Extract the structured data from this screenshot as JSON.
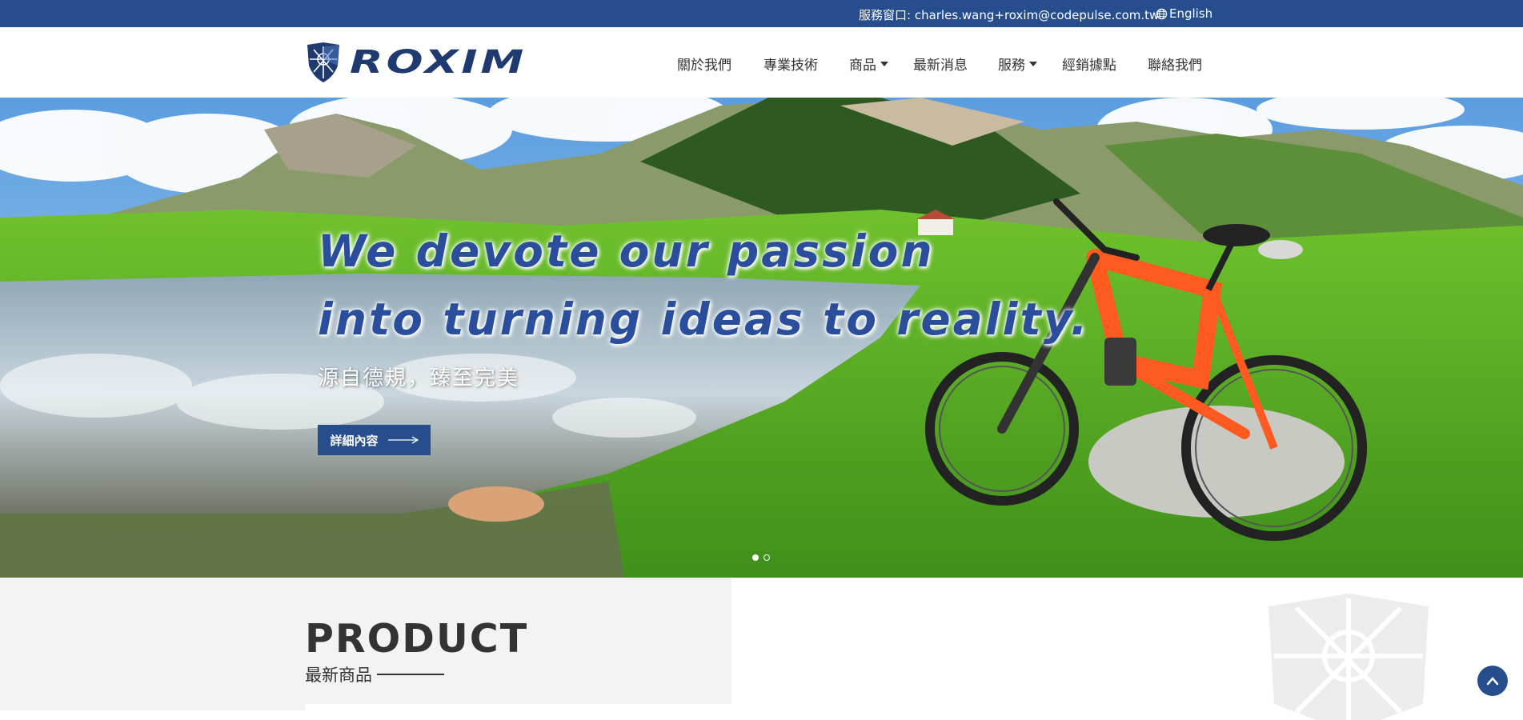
{
  "topbar": {
    "service": "服務窗口: charles.wang+roxim@codepulse.com.tw",
    "language": "English",
    "language_icon": "globe-icon"
  },
  "brand": {
    "name": "ROXIM",
    "primary_color": "#264d8c"
  },
  "nav": {
    "items": [
      {
        "label": "關於我們",
        "has_dropdown": false
      },
      {
        "label": "專業技術",
        "has_dropdown": false
      },
      {
        "label": "商品",
        "has_dropdown": true
      },
      {
        "label": "最新消息",
        "has_dropdown": false
      },
      {
        "label": "服務",
        "has_dropdown": true
      },
      {
        "label": "經銷據點",
        "has_dropdown": false
      },
      {
        "label": "聯絡我們",
        "has_dropdown": false
      }
    ]
  },
  "hero": {
    "headline_line1": "We devote our passion",
    "headline_line2": "into turning ideas to reality.",
    "subtitle": "源自德規，臻至完美",
    "cta_label": "詳細內容",
    "slides": 2,
    "active_slide": 1
  },
  "product": {
    "title": "PRODUCT",
    "subtitle": "最新商品"
  },
  "back_to_top_icon": "chevron-up-icon"
}
